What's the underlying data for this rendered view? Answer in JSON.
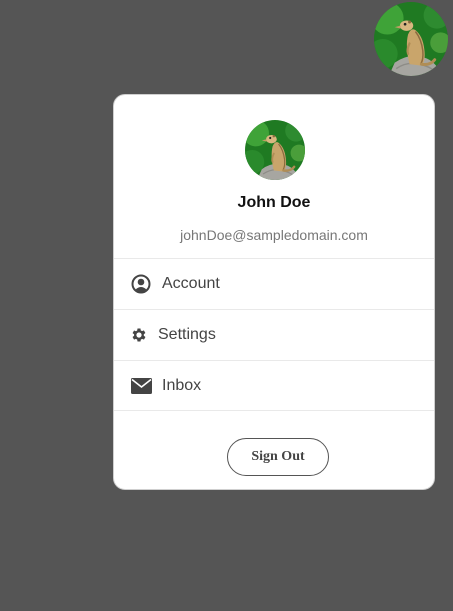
{
  "user": {
    "name": "John Doe",
    "email": "johnDoe@sampledomain.com",
    "avatar_icon": "meerkat-photo"
  },
  "menu": {
    "items": [
      {
        "label": "Account",
        "icon": "user-circle-icon"
      },
      {
        "label": "Settings",
        "icon": "gear-icon"
      },
      {
        "label": "Inbox",
        "icon": "envelope-icon"
      }
    ]
  },
  "actions": {
    "sign_out_label": "Sign Out"
  },
  "colors": {
    "backdrop": "#555555",
    "card_bg": "#ffffff",
    "icon": "#444444",
    "email_text": "#777777"
  }
}
